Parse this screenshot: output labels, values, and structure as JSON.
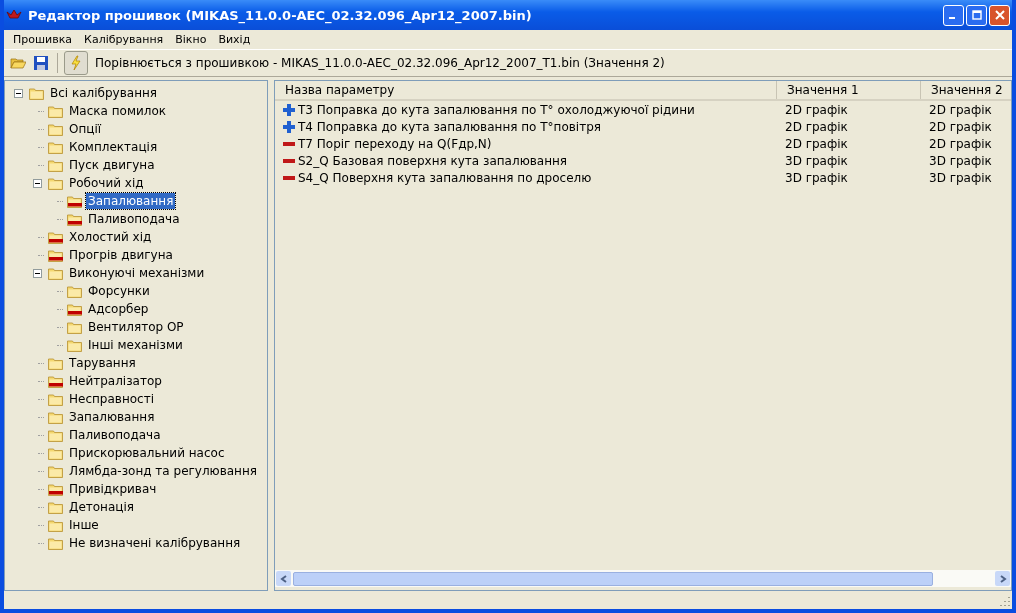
{
  "window": {
    "title": "Редактор прошивок (MIKAS_11.0.0-AEC_02.32.096_Apr12_2007.bin)"
  },
  "menu": [
    "Прошивка",
    "Калібрування",
    "Вікно",
    "Вихід"
  ],
  "toolbar": {
    "compare_text": "Порівнюється з прошивкою - MIKAS_11.0.0-AEC_02.32.096_Apr12_2007_T1.bin (Значення 2)"
  },
  "tree": [
    {
      "label": "Всі калібрування",
      "flagged": false,
      "selected": false,
      "expanded": true,
      "children": [
        {
          "label": "Маска помилок",
          "flagged": false,
          "selected": false
        },
        {
          "label": "Опції",
          "flagged": false,
          "selected": false
        },
        {
          "label": "Комплектація",
          "flagged": false,
          "selected": false
        },
        {
          "label": "Пуск двигуна",
          "flagged": false,
          "selected": false
        },
        {
          "label": "Робочий хід",
          "flagged": false,
          "selected": false,
          "expanded": true,
          "children": [
            {
              "label": "Запалювання",
              "flagged": true,
              "selected": true
            },
            {
              "label": "Паливоподача",
              "flagged": true,
              "selected": false
            }
          ]
        },
        {
          "label": "Холостий хід",
          "flagged": true,
          "selected": false
        },
        {
          "label": "Прогрів двигуна",
          "flagged": true,
          "selected": false
        },
        {
          "label": "Виконуючі механізми",
          "flagged": false,
          "selected": false,
          "expanded": true,
          "children": [
            {
              "label": "Форсунки",
              "flagged": false,
              "selected": false
            },
            {
              "label": "Адсорбер",
              "flagged": true,
              "selected": false
            },
            {
              "label": "Вентилятор ОР",
              "flagged": false,
              "selected": false
            },
            {
              "label": "Інші механізми",
              "flagged": false,
              "selected": false
            }
          ]
        },
        {
          "label": "Тарування",
          "flagged": false,
          "selected": false
        },
        {
          "label": "Нейтралізатор",
          "flagged": true,
          "selected": false
        },
        {
          "label": "Несправності",
          "flagged": false,
          "selected": false
        },
        {
          "label": "Запалювання",
          "flagged": false,
          "selected": false
        },
        {
          "label": "Паливоподача",
          "flagged": false,
          "selected": false
        },
        {
          "label": "Прискорювальний насос",
          "flagged": false,
          "selected": false
        },
        {
          "label": "Лямбда-зонд та регулювання",
          "flagged": false,
          "selected": false
        },
        {
          "label": "Привідкривач",
          "flagged": true,
          "selected": false
        },
        {
          "label": "Детонація",
          "flagged": false,
          "selected": false
        },
        {
          "label": "Інше",
          "flagged": false,
          "selected": false
        },
        {
          "label": "Не визначені калібрування",
          "flagged": false,
          "selected": false
        }
      ]
    }
  ],
  "table": {
    "columns": [
      "Назва параметру",
      "Значення 1",
      "Значення 2"
    ],
    "rows": [
      {
        "kind": "plus",
        "cells": [
          "T3 Поправка до кута запалювання по Т° охолоджуючої рідини",
          "2D графік",
          "2D графік"
        ]
      },
      {
        "kind": "plus",
        "cells": [
          "T4 Поправка до кута запалювання по Т°повітря",
          "2D графік",
          "2D графік"
        ]
      },
      {
        "kind": "minus",
        "cells": [
          "T7 Поріг переходу на Q(Fдр,N)",
          "2D графік",
          "2D графік"
        ]
      },
      {
        "kind": "minus",
        "cells": [
          "S2_Q Базовая поверхня кута запалювання",
          "3D графік",
          "3D графік"
        ]
      },
      {
        "kind": "minus",
        "cells": [
          "S4_Q Поверхня кута запалювання по дроселю",
          "3D графік",
          "3D графік"
        ]
      }
    ]
  }
}
